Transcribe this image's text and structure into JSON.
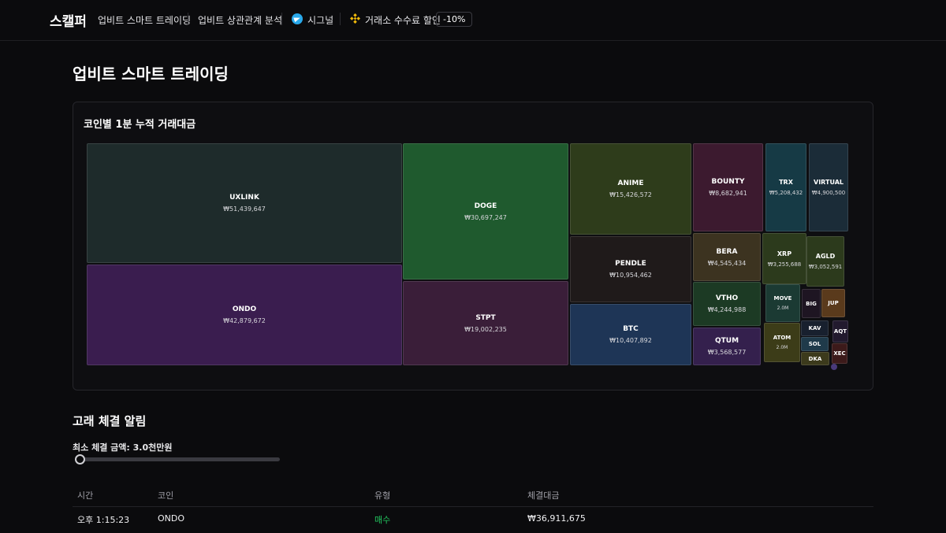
{
  "nav": {
    "logo": "스캘퍼",
    "items": [
      "업비트 스마트 트레이딩",
      "업비트 상관관계 분석",
      "시그널",
      "거래소 수수료 할인"
    ],
    "discount_badge": "-10%"
  },
  "page": {
    "title": "업비트 스마트 트레이딩"
  },
  "treemap": {
    "title": "코인별 1분 누적 거래대금",
    "tiles": [
      {
        "sym": "UXLINK",
        "val": "₩51,439,647",
        "color": "#1e2b2b"
      },
      {
        "sym": "ONDO",
        "val": "₩42,879,672",
        "color": "#3a1d4f"
      },
      {
        "sym": "DOGE",
        "val": "₩30,697,247",
        "color": "#1f5a2e"
      },
      {
        "sym": "STPT",
        "val": "₩19,002,235",
        "color": "#3a1e39"
      },
      {
        "sym": "ANIME",
        "val": "₩15,426,572",
        "color": "#2e3c1b"
      },
      {
        "sym": "PENDLE",
        "val": "₩10,954,462",
        "color": "#1f1a1a"
      },
      {
        "sym": "BTC",
        "val": "₩10,407,892",
        "color": "#1e3556"
      },
      {
        "sym": "BOUNTY",
        "val": "₩8,682,941",
        "color": "#3c1a2f"
      },
      {
        "sym": "TRX",
        "val": "₩5,208,432",
        "color": "#163a45"
      },
      {
        "sym": "VIRTUAL",
        "val": "₩4,900,500",
        "color": "#1b2c38"
      },
      {
        "sym": "BERA",
        "val": "₩4,545,434",
        "color": "#3c3320"
      },
      {
        "sym": "XRP",
        "val": "₩3,255,688",
        "color": "#2c3a1c"
      },
      {
        "sym": "AGLD",
        "val": "₩3,052,591",
        "color": "#2c3a1c"
      },
      {
        "sym": "VTHO",
        "val": "₩4,244,988",
        "color": "#1c3a24"
      },
      {
        "sym": "MOVE",
        "val": "2.0M",
        "color": "#1b3a33"
      },
      {
        "sym": "BIG",
        "val": "",
        "color": "#1e1522"
      },
      {
        "sym": "JUP",
        "val": "",
        "color": "#5a3a1c"
      },
      {
        "sym": "QTUM",
        "val": "₩3,568,577",
        "color": "#34204d"
      },
      {
        "sym": "ATOM",
        "val": "2.0M",
        "color": "#3c3c18"
      },
      {
        "sym": "KAV",
        "val": "",
        "color": "#18202e"
      },
      {
        "sym": "AQT",
        "val": "",
        "color": "#221a2e"
      },
      {
        "sym": "SOL",
        "val": "",
        "color": "#1f3a4a"
      },
      {
        "sym": "DKA",
        "val": "",
        "color": "#3c3a1c"
      },
      {
        "sym": "XEC",
        "val": "",
        "color": "#3c1a1a"
      }
    ]
  },
  "whale": {
    "title": "고래 체결 알림",
    "min_label": "최소 체결 금액: 3.0천만원",
    "slider_fraction": 0.0,
    "columns": [
      "시간",
      "코인",
      "유형",
      "체결대금"
    ],
    "rows": [
      {
        "time": "오후 1:15:23",
        "coin": "ONDO",
        "type": "매수",
        "amount": "₩36,911,675"
      }
    ]
  }
}
